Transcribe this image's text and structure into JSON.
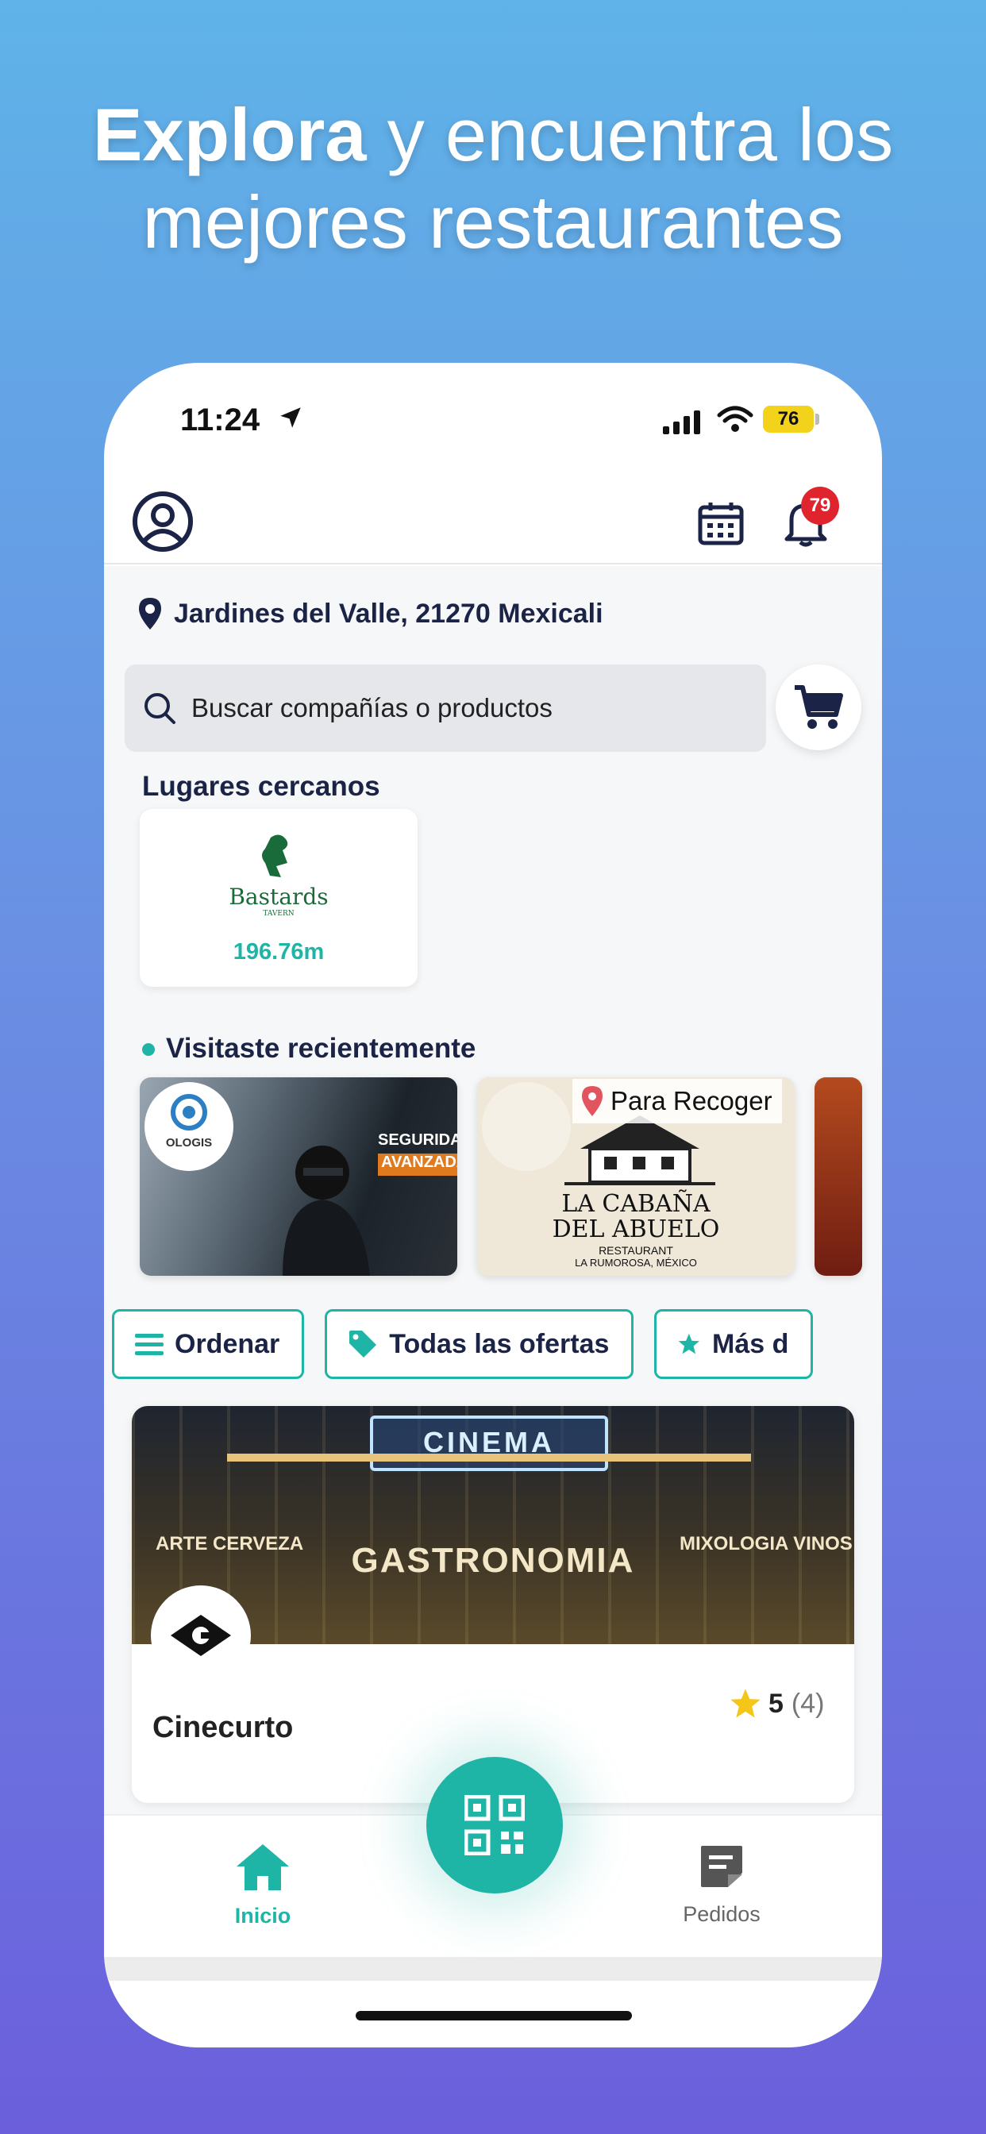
{
  "headline": {
    "bold": "Explora",
    "rest_line1": " y encuentra los",
    "line2": "mejores restaurantes"
  },
  "status": {
    "time": "11:24",
    "battery": "76"
  },
  "header": {
    "notifications_count": "79"
  },
  "location": {
    "text": "Jardines del Valle, 21270 Mexicali"
  },
  "search": {
    "placeholder": "Buscar compañías o productos"
  },
  "nearby": {
    "title": "Lugares cercanos",
    "items": [
      {
        "logo_text": "Bastards",
        "logo_sub": "TAVERN",
        "distance": "196.76m"
      }
    ]
  },
  "recent": {
    "title": "Visitaste recientemente",
    "items": [
      {
        "logo_text": "OLOGIS",
        "banner": "SEGURIDAD",
        "banner2": "AVANZADA"
      },
      {
        "pickup_label": "Para Recoger",
        "name_line1": "LA CABAÑA",
        "name_line2": "DEL ABUELO",
        "sub1": "RESTAURANT",
        "sub2": "LA RUMOROSA, MÉXICO"
      },
      {}
    ]
  },
  "filters": [
    {
      "label": "Ordenar",
      "icon": "menu-icon"
    },
    {
      "label": "Todas las ofertas",
      "icon": "tag-icon"
    },
    {
      "label": "Más d",
      "icon": "star-icon"
    }
  ],
  "featured": {
    "name": "Cinecurto",
    "rating": "5",
    "rating_count": "(4)",
    "sign_top": "CINEMA",
    "sign_main": "GASTRONOMIA",
    "sign_left": "ARTE  CERVEZA",
    "sign_right": "MIXOLOGIA  VINOS"
  },
  "tabbar": {
    "home": "Inicio",
    "orders": "Pedidos"
  },
  "colors": {
    "accent": "#1fb5a6",
    "navy": "#1b2446",
    "badge": "#e0242e"
  }
}
